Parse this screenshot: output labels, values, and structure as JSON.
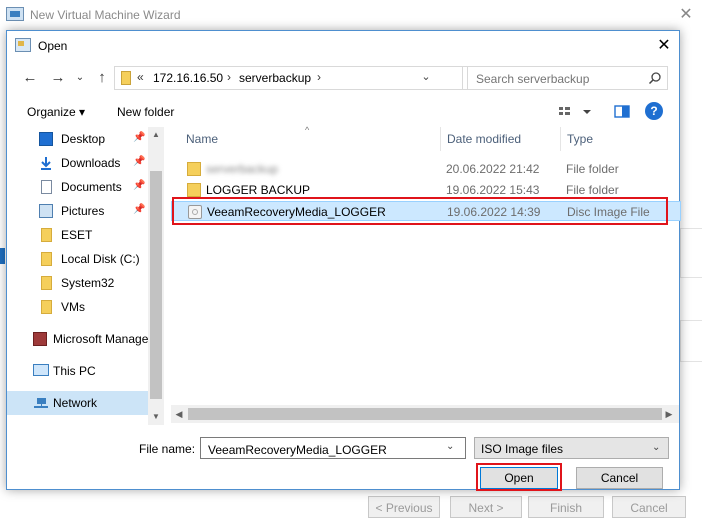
{
  "background_window": {
    "title": "New Virtual Machine Wizard",
    "buttons": [
      "< Previous",
      "Next >",
      "Finish",
      "Cancel"
    ]
  },
  "dialog": {
    "title": "Open",
    "address": {
      "prefix": "«",
      "segments": [
        "172.16.16.50",
        "serverbackup"
      ]
    },
    "search_placeholder": "Search serverbackup",
    "toolbar": {
      "organize": "Organize",
      "new_folder": "New folder"
    },
    "nav_items": [
      {
        "label": "Desktop",
        "icon": "desktop-icon",
        "pinned": true
      },
      {
        "label": "Downloads",
        "icon": "downloads-icon",
        "pinned": true
      },
      {
        "label": "Documents",
        "icon": "documents-icon",
        "pinned": true
      },
      {
        "label": "Pictures",
        "icon": "pictures-icon",
        "pinned": true
      },
      {
        "label": "ESET",
        "icon": "folder-icon",
        "pinned": false
      },
      {
        "label": "Local Disk (C:)",
        "icon": "folder-icon",
        "pinned": false
      },
      {
        "label": "System32",
        "icon": "folder-icon",
        "pinned": false
      },
      {
        "label": "VMs",
        "icon": "folder-icon",
        "pinned": false
      },
      {
        "label": "Microsoft Manage",
        "icon": "mmc-icon",
        "pinned": false
      },
      {
        "label": "This PC",
        "icon": "this-pc-icon",
        "pinned": false
      },
      {
        "label": "Network",
        "icon": "network-icon",
        "pinned": false,
        "selected": true
      }
    ],
    "columns": {
      "name": "Name",
      "date": "Date modified",
      "type": "Type"
    },
    "files": [
      {
        "name": "serverbackup",
        "date": "20.06.2022 21:42",
        "type": "File folder",
        "icon": "folder-icon",
        "blurred": true
      },
      {
        "name": "LOGGER BACKUP",
        "date": "19.06.2022 15:43",
        "type": "File folder",
        "icon": "folder-icon"
      },
      {
        "name": "VeeamRecoveryMedia_LOGGER",
        "date": "19.06.2022 14:39",
        "type": "Disc Image File",
        "icon": "disc-image-icon",
        "selected": true
      }
    ],
    "file_name_label": "File name:",
    "file_name_value": "VeeamRecoveryMedia_LOGGER",
    "file_type_filter": "ISO Image files",
    "open_label": "Open",
    "cancel_label": "Cancel",
    "highlight_color": "#e0141b",
    "accent_color": "#0078d7"
  }
}
